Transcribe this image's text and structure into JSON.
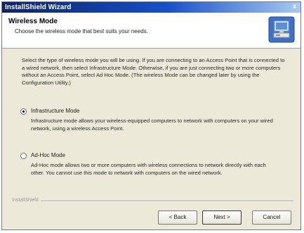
{
  "window": {
    "title": "InstallShield Wizard",
    "close_glyph": "x"
  },
  "header": {
    "title": "Wireless Mode",
    "subtitle": "Choose the wireless mode that best suits your needs.",
    "icon": "setup-computer-icon"
  },
  "body": {
    "intro": "Select the type of wireless mode you will be using. If you are connecting to an Access Point that is connected to a wired network, then select Infrastructure Mode. Otherwise, if you are just connecting two or more computers without an Access Point, select Ad Hoc Mode. (The wireless Mode can be changed later by using the Configuration Utility.)"
  },
  "options": [
    {
      "label": "Infrastructure Mode",
      "description": "Infrastructure mode allows your wireless-equipped computers to network with computers on your wired network, using a wireless Access Point.",
      "selected": true
    },
    {
      "label": "Ad-Hoc Mode",
      "description": "Ad-Hoc mode allows two or more computers with wireless connections to network directly with each other. You cannot use this mode to network with computers on the wired network.",
      "selected": false
    }
  ],
  "footer": {
    "brand": "InstallShield"
  },
  "buttons": {
    "back": "< Back",
    "next": "Next >",
    "cancel": "Cancel"
  },
  "colors": {
    "titlebar_start": "#0a246a",
    "titlebar_end": "#a6caf0",
    "dialog_background": "#ece9d8",
    "header_background": "#ffffff"
  }
}
